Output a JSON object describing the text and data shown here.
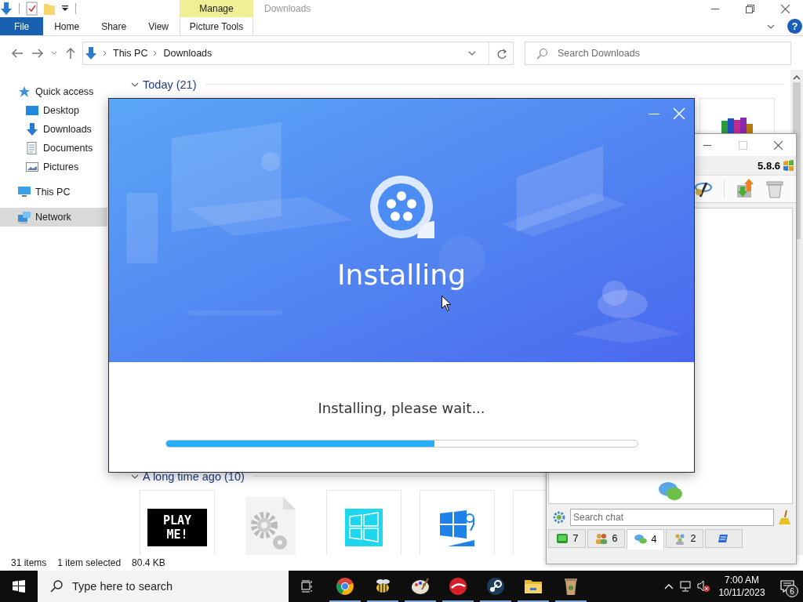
{
  "explorer": {
    "context_group": "Manage",
    "title": "Downloads",
    "help_label": "?",
    "ribbon_tabs": [
      {
        "label": "File",
        "kind": "file",
        "selected": false
      },
      {
        "label": "Home",
        "kind": "tab",
        "selected": false
      },
      {
        "label": "Share",
        "kind": "tab",
        "selected": false
      },
      {
        "label": "View",
        "kind": "tab",
        "selected": false
      },
      {
        "label": "Picture Tools",
        "kind": "contextual",
        "selected": false
      }
    ],
    "breadcrumb": [
      "This PC",
      "Downloads"
    ],
    "search": {
      "placeholder": "Search Downloads"
    },
    "nav": [
      {
        "label": "Quick access",
        "kind": "star",
        "selected": false,
        "children": [
          {
            "label": "Desktop",
            "kind": "desktop",
            "selected": false
          },
          {
            "label": "Downloads",
            "kind": "downloads",
            "selected": false
          },
          {
            "label": "Documents",
            "kind": "documents",
            "selected": false
          },
          {
            "label": "Pictures",
            "kind": "pictures",
            "selected": false
          }
        ]
      },
      {
        "label": "This PC",
        "kind": "pc",
        "selected": false
      },
      {
        "label": "Network",
        "kind": "network",
        "selected": true
      }
    ],
    "groups": [
      {
        "label": "Today (21)",
        "expanded": true,
        "items": [
          {
            "kind": "books"
          }
        ]
      },
      {
        "label": "A long time ago (10)",
        "expanded": true,
        "items": [
          {
            "kind": "playme",
            "text": "PLAY ME!"
          },
          {
            "kind": "gears"
          },
          {
            "kind": "tile"
          },
          {
            "kind": "logo"
          },
          {
            "kind": "blank"
          }
        ]
      }
    ],
    "status_bar": {
      "items": "31 items",
      "selected": "1 item selected",
      "size": "80.4 KB"
    }
  },
  "chat": {
    "version": "5.8.6",
    "search": {
      "placeholder": "Search chat"
    },
    "tabs": [
      {
        "kind": "contacts",
        "count": "7",
        "selected": false
      },
      {
        "kind": "users",
        "count": "6",
        "selected": false
      },
      {
        "kind": "chat",
        "count": "4",
        "selected": true
      },
      {
        "kind": "groups",
        "count": "2",
        "selected": false
      },
      {
        "kind": "scroll",
        "selected": false
      }
    ]
  },
  "installer": {
    "heading": "Installing",
    "message": "Installing, please wait...",
    "progress": {
      "level": 0.57
    }
  },
  "taskbar": {
    "search": {
      "placeholder": "Type here to search"
    },
    "time": "7:00 AM",
    "date": "10/11/2023",
    "notifications": "6"
  }
}
